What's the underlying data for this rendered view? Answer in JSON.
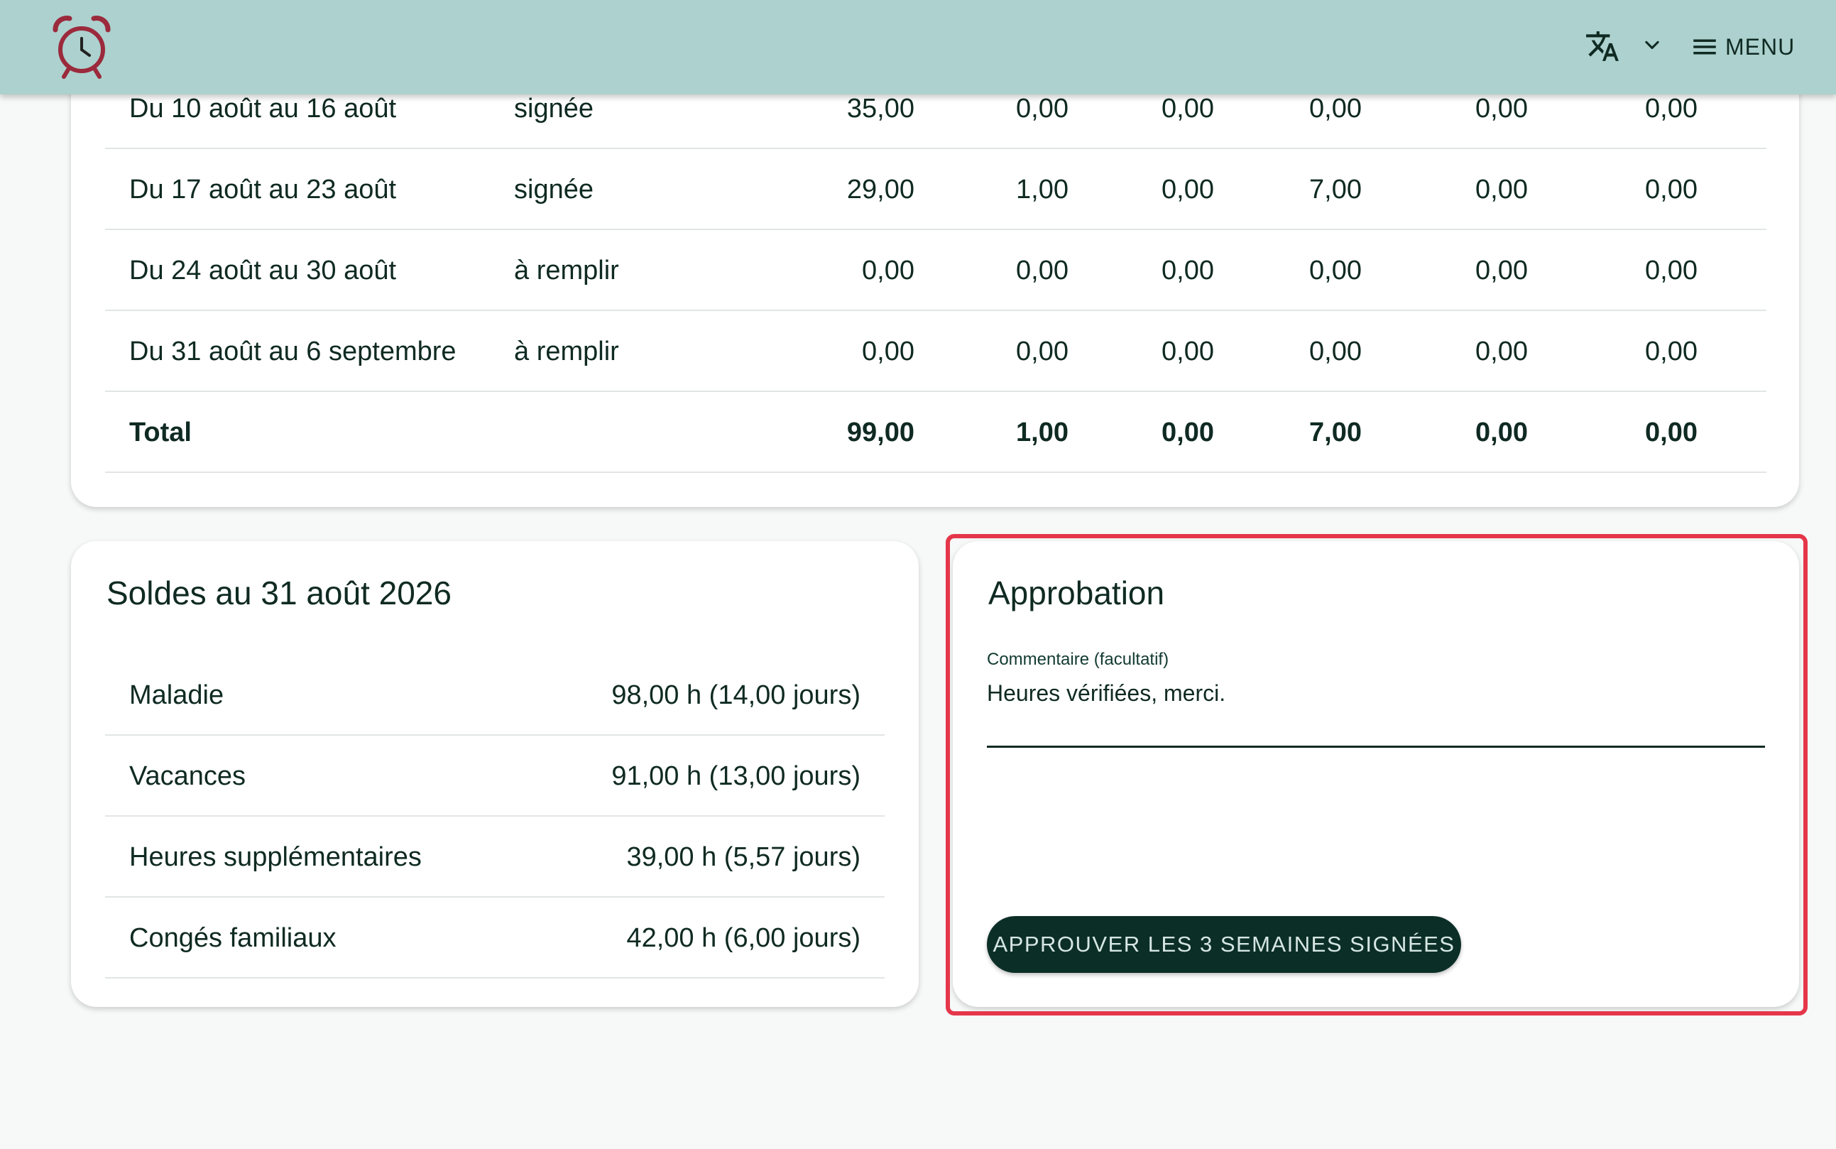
{
  "header": {
    "logo_icon": "alarm-clock-icon",
    "language_icon": "translate-icon",
    "dropdown_icon": "chevron-down-icon",
    "menu_icon": "hamburger-menu-icon",
    "menu_label": "MENU",
    "colors": {
      "appbar": "#acd1ce",
      "logo": "#9b2a3c"
    }
  },
  "weeks": {
    "rows": [
      {
        "period": "Du 10 août au 16 août",
        "status": "signée",
        "v1": "35,00",
        "v2": "0,00",
        "v3": "0,00",
        "v4": "0,00",
        "v5": "0,00",
        "v6": "0,00"
      },
      {
        "period": "Du 17 août au 23 août",
        "status": "signée",
        "v1": "29,00",
        "v2": "1,00",
        "v3": "0,00",
        "v4": "7,00",
        "v5": "0,00",
        "v6": "0,00"
      },
      {
        "period": "Du 24 août au 30 août",
        "status": "à remplir",
        "v1": "0,00",
        "v2": "0,00",
        "v3": "0,00",
        "v4": "0,00",
        "v5": "0,00",
        "v6": "0,00"
      },
      {
        "period": "Du 31 août au 6 septembre",
        "status": "à remplir",
        "v1": "0,00",
        "v2": "0,00",
        "v3": "0,00",
        "v4": "0,00",
        "v5": "0,00",
        "v6": "0,00"
      }
    ],
    "total": {
      "label": "Total",
      "v1": "99,00",
      "v2": "1,00",
      "v3": "0,00",
      "v4": "7,00",
      "v5": "0,00",
      "v6": "0,00"
    }
  },
  "balances": {
    "title": "Soldes au 31 août 2026",
    "rows": [
      {
        "label": "Maladie",
        "value": "98,00 h (14,00 jours)"
      },
      {
        "label": "Vacances",
        "value": "91,00 h (13,00 jours)"
      },
      {
        "label": "Heures supplémentaires",
        "value": "39,00 h (5,57 jours)"
      },
      {
        "label": "Congés familiaux",
        "value": "42,00 h (6,00 jours)"
      }
    ]
  },
  "approval": {
    "title": "Approbation",
    "comment_label": "Commentaire (facultatif)",
    "comment_value": "Heures vérifiées, merci.",
    "approve_button": "APPROUVER LES 3 SEMAINES SIGNÉES",
    "highlight_color": "#e5374a"
  }
}
